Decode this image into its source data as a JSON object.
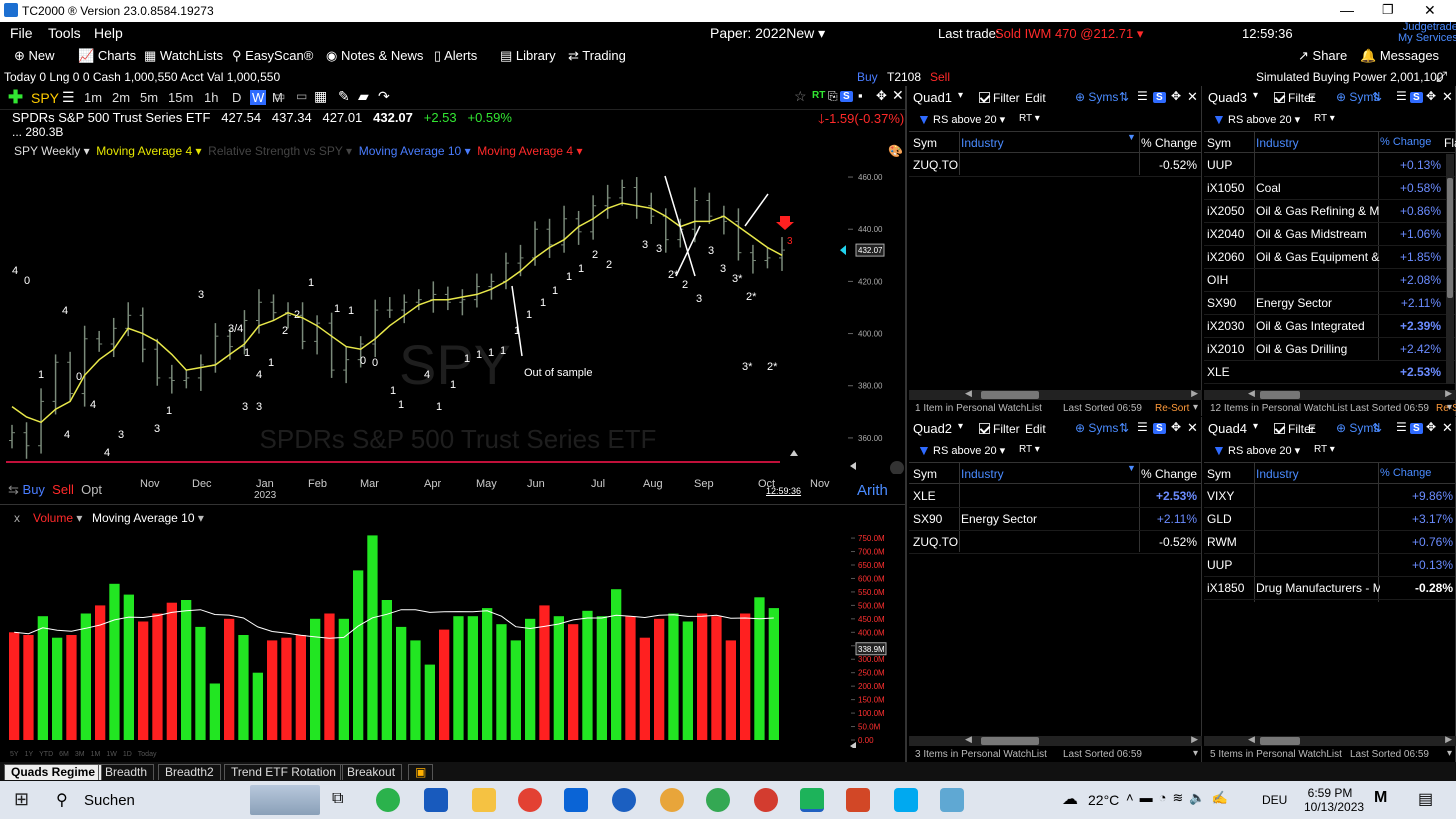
{
  "titlebar": {
    "app": "TC2000 ® Version 23.0.8584.19273",
    "brand_line1": "Judgetrade",
    "brand_line2": "My Services"
  },
  "menu": {
    "file": "File",
    "tools": "Tools",
    "help": "Help",
    "paper": "Paper: 2022New",
    "last_trade_label": "Last trade:",
    "last_trade_value": "Sold IWM 470 @212.71",
    "clock": "12:59:36"
  },
  "toolbar": {
    "new": "New",
    "charts": "Charts",
    "watchlists": "WatchLists",
    "easyscan": "EasyScan®",
    "notes": "Notes & News",
    "alerts": "Alerts",
    "library": "Library",
    "trading": "Trading",
    "share": "Share",
    "messages": "Messages"
  },
  "account": {
    "today": "Today",
    "today_val": "0",
    "lng": "Lng",
    "lng_val": "0",
    "lng_val2": "0",
    "cash": "Cash",
    "cash_val": "1,000,550",
    "acct": "Acct Val",
    "acct_val": "1,000,550",
    "buy": "Buy",
    "ticker": "T2108",
    "sell": "Sell",
    "sbp_label": "Simulated Buying Power",
    "sbp_val": "2,001,100"
  },
  "chart": {
    "symbol": "SPY",
    "timeframes": [
      "1m",
      "2m",
      "5m",
      "15m",
      "1h",
      "D",
      "W",
      "M"
    ],
    "selected_tf": "W",
    "name": "SPDRs S&P 500 Trust Series ETF",
    "open": "427.54",
    "high": "437.34",
    "low": "427.01",
    "close": "432.07",
    "chg": "+2.53",
    "chg_pct": "+0.59%",
    "mktcap": "280.3B",
    "ellipsis": "...",
    "right_chg": "-1.59",
    "right_chg_pct": "(-0.37%)",
    "indicators": {
      "weekly": "SPY Weekly",
      "ma4": "Moving Average 4",
      "rs": "Relative Strength vs SPY",
      "ma10": "Moving Average 10",
      "ma4b": "Moving Average 4"
    },
    "watermark_sym": "SPY",
    "watermark_name": "SPDRs S&P 500 Trust Series ETF",
    "annotation": "Out of sample",
    "buy": "Buy",
    "sell": "Sell",
    "opt": "Opt",
    "arith": "Arith",
    "time_stamp": "12:59:36",
    "last_price_tag": "432.07",
    "price_axis": [
      "460.00",
      "440.00",
      "420.00",
      "400.00",
      "380.00",
      "360.00"
    ],
    "months": [
      "Nov",
      "Dec",
      "Jan",
      "Feb",
      "Mar",
      "Apr",
      "May",
      "Jun",
      "Jul",
      "Aug",
      "Sep",
      "Oct",
      "Nov"
    ],
    "year": "2023",
    "counts": [
      "4",
      "0",
      "4",
      "1",
      "4",
      "3",
      "4",
      "4",
      "0",
      "3",
      "1",
      "3",
      "3/4",
      "1",
      "4",
      "3",
      "3",
      "1",
      "2",
      "2",
      "1",
      "1",
      "0",
      "1",
      "0",
      "1",
      "1",
      "4",
      "1",
      "1",
      "1",
      "1",
      "1",
      "1",
      "1",
      "1",
      "1",
      "1",
      "1",
      "1",
      "2",
      "2",
      "3",
      "3",
      "2*",
      "2",
      "3",
      "3",
      "3",
      "3*",
      "2*"
    ],
    "volume": {
      "label": "Volume",
      "ma": "Moving Average 10",
      "axis": [
        "750.0M",
        "700.0M",
        "650.0M",
        "600.0M",
        "550.0M",
        "500.0M",
        "450.0M",
        "400.0M",
        "350.0M",
        "300.0M",
        "250.0M",
        "200.0M",
        "150.0M",
        "100.0M",
        "50.0M",
        "0.00"
      ],
      "last_tag": "338.9M"
    },
    "bottom_tfs": [
      "5Y",
      "1Y",
      "YTD",
      "6M",
      "3M",
      "1M",
      "1W",
      "1D",
      "Today"
    ]
  },
  "chart_data": {
    "type": "bar",
    "title": "SPY Weekly",
    "x": [
      "2022-10-07",
      "2022-10-14",
      "2022-10-21",
      "2022-10-28",
      "2022-11-04",
      "2022-11-11",
      "2022-11-18",
      "2022-11-25",
      "2022-12-02",
      "2022-12-09",
      "2022-12-16",
      "2022-12-23",
      "2022-12-30",
      "2023-01-06",
      "2023-01-13",
      "2023-01-20",
      "2023-01-27",
      "2023-02-03",
      "2023-02-10",
      "2023-02-17",
      "2023-02-24",
      "2023-03-03",
      "2023-03-10",
      "2023-03-17",
      "2023-03-24",
      "2023-03-31",
      "2023-04-06",
      "2023-04-14",
      "2023-04-21",
      "2023-04-28",
      "2023-05-05",
      "2023-05-12",
      "2023-05-19",
      "2023-05-26",
      "2023-06-02",
      "2023-06-09",
      "2023-06-16",
      "2023-06-23",
      "2023-06-30",
      "2023-07-07",
      "2023-07-14",
      "2023-07-21",
      "2023-07-28",
      "2023-08-04",
      "2023-08-11",
      "2023-08-18",
      "2023-08-25",
      "2023-09-01",
      "2023-09-08",
      "2023-09-15",
      "2023-09-22",
      "2023-09-29",
      "2023-10-06",
      "2023-10-13"
    ],
    "close": [
      362,
      357,
      374,
      389,
      377,
      398,
      396,
      402,
      407,
      394,
      383,
      382,
      383,
      388,
      399,
      395,
      405,
      412,
      408,
      407,
      397,
      404,
      386,
      390,
      396,
      409,
      409,
      412,
      413,
      415,
      412,
      413,
      418,
      420,
      427,
      429,
      440,
      434,
      444,
      439,
      449,
      452,
      456,
      449,
      445,
      436,
      440,
      451,
      445,
      443,
      431,
      428,
      429,
      432
    ],
    "ma4": [
      372,
      368,
      366,
      371,
      374,
      384,
      390,
      394,
      402,
      400,
      397,
      392,
      386,
      387,
      388,
      392,
      396,
      403,
      405,
      408,
      406,
      403,
      399,
      395,
      394,
      398,
      403,
      407,
      411,
      413,
      413,
      414,
      415,
      417,
      420,
      424,
      429,
      433,
      436,
      441,
      444,
      448,
      450,
      449,
      448,
      445,
      441,
      443,
      443,
      445,
      441,
      437,
      433,
      430
    ],
    "volume_m": [
      400,
      390,
      460,
      380,
      390,
      470,
      500,
      580,
      540,
      440,
      470,
      510,
      520,
      420,
      210,
      450,
      390,
      250,
      370,
      380,
      390,
      450,
      470,
      450,
      630,
      760,
      520,
      420,
      370,
      280,
      410,
      460,
      460,
      490,
      430,
      370,
      450,
      500,
      460,
      430,
      480,
      460,
      560,
      460,
      380,
      450,
      470,
      440,
      470,
      460,
      370,
      470,
      530,
      490
    ],
    "ylim": [
      350,
      465
    ],
    "volume_ylim": [
      0,
      780
    ]
  },
  "quad1": {
    "title": "Quad1",
    "filter": "Filter",
    "edit": "Edit",
    "syms": "Syms",
    "condition": "RS above 20",
    "rt": "RT",
    "cols": [
      "Sym",
      "Industry",
      "% Change"
    ],
    "rows": [
      {
        "sym": "ZUQ.TO",
        "ind": "",
        "chg": "-0.52%",
        "pos": false
      }
    ],
    "footer": "1 Item in Personal WatchList",
    "sorted": "Last Sorted 06:59",
    "resort": "Re-Sort"
  },
  "quad2": {
    "title": "Quad2",
    "filter": "Filter",
    "edit": "Edit",
    "syms": "Syms",
    "condition": "RS above 20",
    "rt": "RT",
    "cols": [
      "Sym",
      "Industry",
      "% Change"
    ],
    "rows": [
      {
        "sym": "XLE",
        "ind": "",
        "chg": "+2.53%",
        "pos": true
      },
      {
        "sym": "SX90",
        "ind": "Energy Sector",
        "chg": "+2.11%",
        "pos": true
      },
      {
        "sym": "ZUQ.TO",
        "ind": "",
        "chg": "-0.52%",
        "pos": false
      }
    ],
    "footer": "3 Items in Personal WatchList",
    "sorted": "Last Sorted 06:59"
  },
  "quad3": {
    "title": "Quad3",
    "filter": "Filter",
    "edit": "E",
    "syms": "Syms",
    "condition": "RS above 20",
    "rt": "RT",
    "cols": [
      "Sym",
      "Industry",
      "% Change",
      "Fla"
    ],
    "rows": [
      {
        "sym": "UUP",
        "ind": "",
        "chg": "+0.13%",
        "pos": true
      },
      {
        "sym": "iX1050",
        "ind": "Coal",
        "chg": "+0.58%",
        "pos": true
      },
      {
        "sym": "iX2050",
        "ind": "Oil & Gas Refining & M",
        "chg": "+0.86%",
        "pos": true
      },
      {
        "sym": "iX2040",
        "ind": "Oil & Gas Midstream",
        "chg": "+1.06%",
        "pos": true
      },
      {
        "sym": "iX2060",
        "ind": "Oil & Gas Equipment &",
        "chg": "+1.85%",
        "pos": true
      },
      {
        "sym": "OIH",
        "ind": "",
        "chg": "+2.08%",
        "pos": true
      },
      {
        "sym": "SX90",
        "ind": "Energy Sector",
        "chg": "+2.11%",
        "pos": true
      },
      {
        "sym": "iX2030",
        "ind": "Oil & Gas Integrated",
        "chg": "+2.39%",
        "pos": true
      },
      {
        "sym": "iX2010",
        "ind": "Oil & Gas Drilling",
        "chg": "+2.42%",
        "pos": true
      },
      {
        "sym": "XLE",
        "ind": "",
        "chg": "+2.53%",
        "pos": true
      }
    ],
    "footer": "12 Items in Personal WatchList",
    "sorted": "Last Sorted 06:59",
    "resort": "Re-S"
  },
  "quad4": {
    "title": "Quad4",
    "filter": "Filter",
    "edit": "E",
    "syms": "Syms",
    "condition": "RS above 20",
    "rt": "RT",
    "cols": [
      "Sym",
      "Industry",
      "% Change"
    ],
    "rows": [
      {
        "sym": "VIXY",
        "ind": "",
        "chg": "+9.86%",
        "pos": true
      },
      {
        "sym": "GLD",
        "ind": "",
        "chg": "+3.17%",
        "pos": true
      },
      {
        "sym": "RWM",
        "ind": "",
        "chg": "+0.76%",
        "pos": true
      },
      {
        "sym": "UUP",
        "ind": "",
        "chg": "+0.13%",
        "pos": true
      },
      {
        "sym": "iX1850",
        "ind": "Drug Manufacturers - Majo",
        "chg": "-0.28%",
        "pos": false
      }
    ],
    "footer": "5 Items in Personal WatchList",
    "sorted": "Last Sorted 06:59"
  },
  "sheet_tabs": [
    "Quads Regime",
    "Breadth",
    "Breadth2",
    "Trend ETF Rotation",
    "Breakout"
  ],
  "taskbar": {
    "search": "Suchen",
    "temp": "22°C",
    "lang": "DEU",
    "time": "6:59 PM",
    "date": "10/13/2023"
  },
  "colors": {
    "up": "#22e622",
    "down": "#ff2020",
    "ma": "#e8e84a",
    "accent_blue": "#2f6bff"
  }
}
